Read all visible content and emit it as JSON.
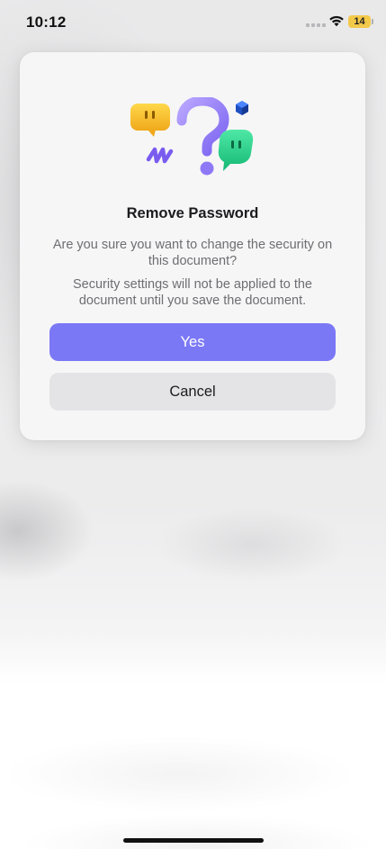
{
  "status_bar": {
    "time": "10:12",
    "battery_level": "14",
    "battery_color": "#f3c94a",
    "icons": [
      "signal-icon",
      "wifi-icon",
      "battery-icon"
    ]
  },
  "dialog": {
    "illustration_icons": [
      "yellow-chat-bubble-icon",
      "question-mark-icon",
      "green-chat-bubble-icon",
      "purple-squiggle-icon",
      "blue-cube-icon"
    ],
    "title": "Remove Password",
    "message": "Are you sure you want to change the security on this document?",
    "detail": "Security settings will not be applied to the document until you save the document.",
    "buttons": {
      "yes_label": "Yes",
      "cancel_label": "Cancel"
    }
  },
  "colors": {
    "accent": "#7b78f6",
    "secondary_button": "#e4e4e6",
    "text_primary": "#1c1c1e",
    "text_secondary": "#6e6e72"
  }
}
